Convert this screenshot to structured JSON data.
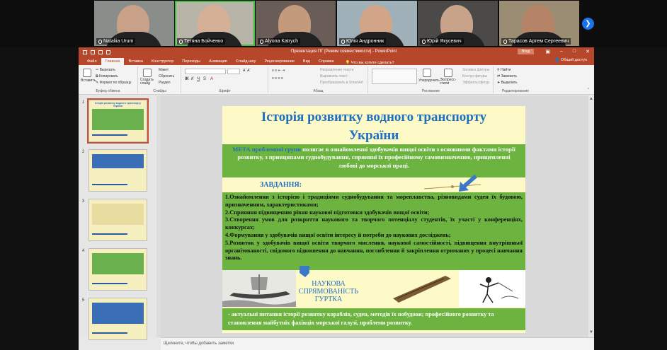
{
  "participants": [
    {
      "name": "Nataliia Urum",
      "skin": "#c9a088",
      "bg": "#8a8e8a",
      "active": false
    },
    {
      "name": "Тетяна Бойченко",
      "skin": "#d6b096",
      "bg": "#b9b4a8",
      "active": true
    },
    {
      "name": "Alyona Katrych",
      "skin": "#c49a7c",
      "bg": "#6a5d58",
      "active": false
    },
    {
      "name": "Юлія Андронник",
      "skin": "#d2a588",
      "bg": "#9fb0b8",
      "active": false
    },
    {
      "name": "Юрій Якусевич",
      "skin": "#c8a38a",
      "bg": "#4c4a48",
      "active": false
    },
    {
      "name": "Тарасов Артем Сергеевич",
      "skin": "#b58466",
      "bg": "#9a8d74",
      "active": false
    }
  ],
  "window": {
    "title": "Презентация ПГ [Режим совместимости] - PowerPoint",
    "signin": "Вход"
  },
  "ribbon_tabs": [
    "Файл",
    "Главная",
    "Вставка",
    "Конструктор",
    "Переходы",
    "Анимация",
    "Слайд-шоу",
    "Рецензирование",
    "Вид",
    "Справка"
  ],
  "tell_me": "Что вы хотите сделать?",
  "share": "Общий доступ",
  "ribbon": {
    "paste": "Вставить",
    "cut": "Вырезать",
    "copy": "Копировать",
    "format_painter": "Формат по образцу",
    "clipboard": "Буфер обмена",
    "new_slide": "Создать слайд",
    "layout": "Макет",
    "reset": "Сбросить",
    "section": "Раздел",
    "slides": "Слайды",
    "font": "Шрифт",
    "text_direction": "Направление текста",
    "align_text": "Выровнять текст",
    "smartart": "Преобразовать в SmartArt",
    "paragraph": "Абзац",
    "arrange": "Упорядочить",
    "quick_styles": "Экспресс-стили",
    "drawing": "Рисование",
    "shape_fill": "Заливка фигуры",
    "shape_outline": "Контур фигуры",
    "shape_effects": "Эффекты фигур",
    "find": "Найти",
    "replace": "Заменить",
    "select": "Выделить",
    "editing": "Редактирование"
  },
  "slide": {
    "title_line1": "Історія розвитку водного транспорту",
    "title_line2": "України",
    "meta_prefix": "МЕТА",
    "meta_hl": "проблемної групи",
    "meta_text": " полягає в ознайомленні здобувачів вищої освіти з основними фактами історії розвитку, з принципами суднобудування, сприянні їх професійному самовизначенню, прищепленні любові до морської праці.",
    "tasks_label": "ЗАВДАННЯ:",
    "tasks": [
      "1.Ознайомлення з історією і традиціями суднобудування та мореплавства, різновидами суден їх будовою, призначенням, характеристиками;",
      "2.Сприяння підвищенню рівня наукової підготовки здобувачів вищої освіти;",
      "3.Створення умов для розкриття наукового та творчого потенціалу студентів, їх участі у конференціях, конкурсах;",
      "4.Формування у здобувачів вищої освіти інтересу й потреби до наукових досліджень;",
      "5.Розвиток у здобувачів вищої освіти творчого мислення, наукової самостійності, підвищення внутрішньої організованості, свідомого відношення до навчання, поглиблення й закріплення отриманих у процесі навчання знань."
    ],
    "direction_title": "НАУКОВА СПРЯМОВАНІСТЬ ГУРТКА",
    "direction_text": "-  актуальні питання історії розвитку кораблів, суден, методів їх побудови; професійного розвитку та становлення майбутніх фахівців морської галузі, проблеми розвитку."
  },
  "thumbnails": [
    {
      "num": "1",
      "title": "Історія розвитку водного транспорту України",
      "selected": true
    },
    {
      "num": "2",
      "selected": false
    },
    {
      "num": "3",
      "selected": false
    },
    {
      "num": "4",
      "selected": false
    },
    {
      "num": "5",
      "selected": false
    }
  ],
  "notes_placeholder": "Щелкните, чтобы добавить заметки",
  "colors": {
    "accent": "#b7472a",
    "slide_green": "#6db33f",
    "slide_blue": "#1f6fc0",
    "slide_bg": "#fdfac8"
  }
}
